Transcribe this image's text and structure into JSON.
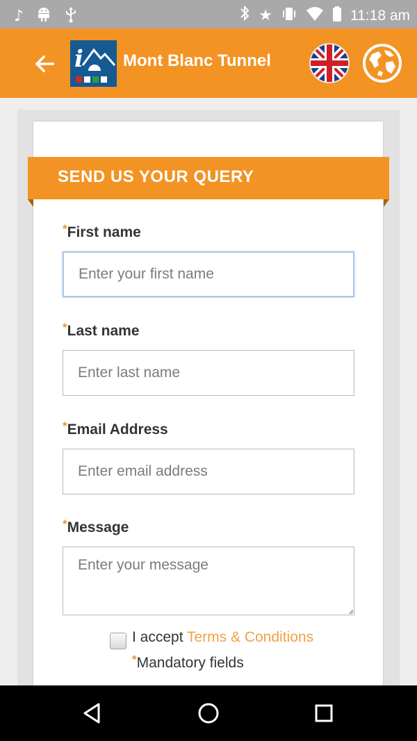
{
  "status_bar": {
    "time": "11:18 am",
    "left_icons": [
      "music-note-icon",
      "android-icon",
      "usb-icon"
    ],
    "right_icons": [
      "bluetooth-icon",
      "star-icon",
      "vibrate-icon",
      "wifi-icon",
      "battery-icon"
    ]
  },
  "app_bar": {
    "title": "Mont Blanc Tunnel",
    "logo_text": "i"
  },
  "form": {
    "heading": "SEND US YOUR QUERY",
    "required_mark": "*",
    "first_name": {
      "label": "First name",
      "placeholder": "Enter your first name"
    },
    "last_name": {
      "label": "Last name",
      "placeholder": "Enter last name"
    },
    "email": {
      "label": "Email Address",
      "placeholder": "Enter email address"
    },
    "message": {
      "label": "Message",
      "placeholder": "Enter your message"
    },
    "accept_prefix": "I accept ",
    "terms_link": "Terms & Conditions",
    "mandatory_note": "Mandatory fields"
  },
  "colors": {
    "brand_orange": "#f39323",
    "logo_blue": "#155a93",
    "link_orange": "#f3a046"
  }
}
